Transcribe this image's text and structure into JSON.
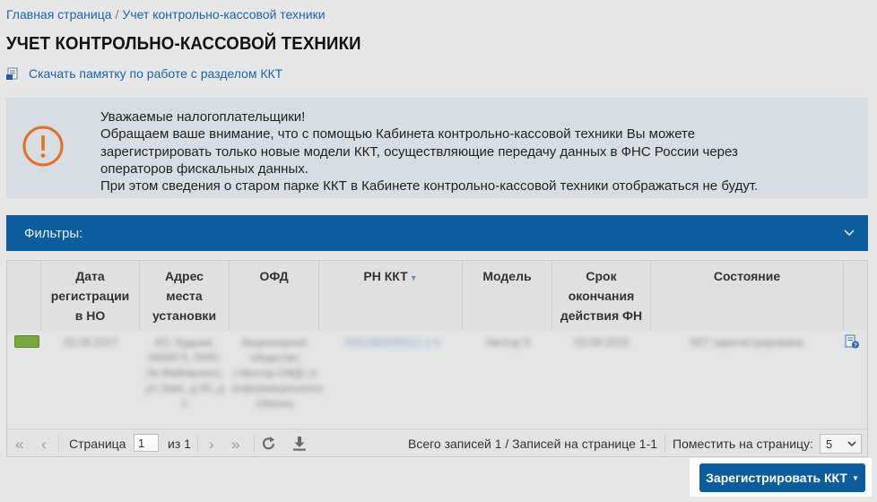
{
  "breadcrumb": {
    "home": "Главная страница",
    "separator": "/",
    "current": "Учет контрольно-кассовой техники"
  },
  "page_title": "УЧЕТ КОНТРОЛЬНО-КАССОВОЙ ТЕХНИКИ",
  "memo_link": "Скачать памятку по работе с разделом ККТ",
  "notice": {
    "icon": "exclamation-circle-icon",
    "lines": [
      "Уважаемые налогоплательщики!",
      "Обращаем ваше внимание, что с помощью Кабинета контрольно-кассовой техники Вы можете",
      "зарегистрировать только новые модели ККТ, осуществляющие передачу данных в ФНС России через",
      "операторов фискальных данных.",
      "При этом сведения о старом парке ККТ в Кабинете контрольно-кассовой техники отображаться не будут."
    ]
  },
  "filters": {
    "label": "Фильтры:"
  },
  "table": {
    "columns": [
      {
        "label": "Дата регистрации в НО"
      },
      {
        "label": "Адрес места установки"
      },
      {
        "label": "ОФД"
      },
      {
        "label": "РН ККТ"
      },
      {
        "label": "Модель"
      },
      {
        "label": "Срок окончания действия ФН"
      },
      {
        "label": "Состояние"
      }
    ],
    "rows": [
      {
        "date": "03.08.2017",
        "address": "АО, Кудымк, 00000 К, 0000, Ла Майовского, ул Заве, д 00, д 1",
        "ofd": "Акционерное общество «Эвотор-ОФД» и информационного обмена",
        "rn": "0001382000013 1 0",
        "model": "Эвотор 5",
        "fn_expiry": "03.08.2018",
        "status": "ККТ зарегистрирована"
      }
    ]
  },
  "pager": {
    "page_label": "Страница",
    "page_value": "1",
    "of_label": "из 1",
    "summary": "Всего записей 1 / Записей на странице 1-1",
    "per_page_label": "Поместить на страницу:",
    "per_page_value": "5"
  },
  "register_button": "Зарегистрировать ККТ",
  "colors": {
    "primary": "#0d5c9c",
    "link": "#1d64ad",
    "notice_icon": "#e2702c",
    "status_active": "#77a73d"
  }
}
